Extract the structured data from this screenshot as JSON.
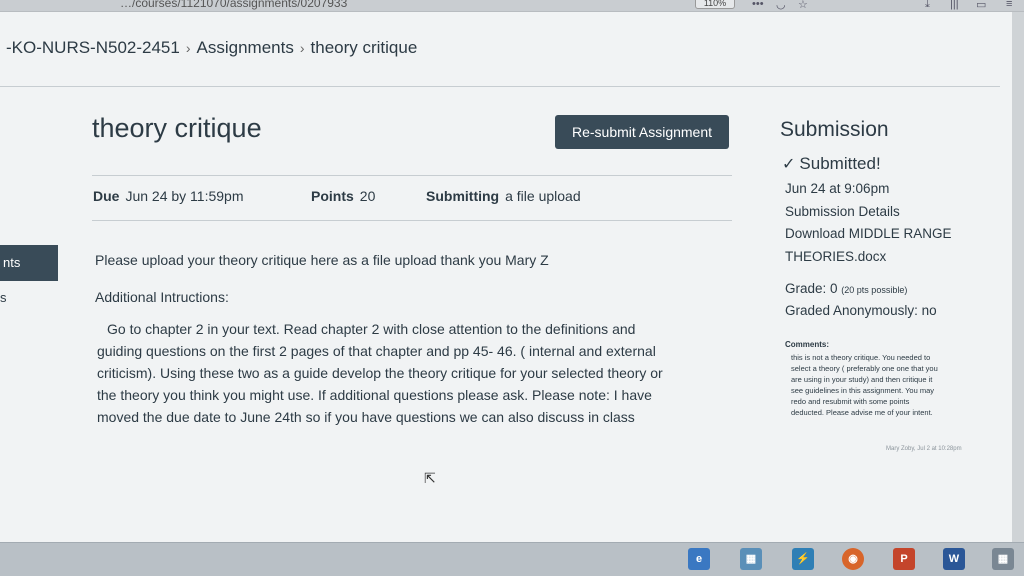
{
  "browser": {
    "url_fragment": "…/courses/1121070/assignments/0207933",
    "zoom": "110%",
    "icons": [
      "more-icon",
      "pocket-icon",
      "star-icon",
      "download-icon",
      "library-icon",
      "sidebar-icon",
      "menu-icon"
    ]
  },
  "breadcrumb": {
    "course": "-KO-NURS-N502-2451",
    "section": "Assignments",
    "current": "theory critique"
  },
  "left_nav": {
    "active_label": "nts",
    "next_label": "s"
  },
  "assignment": {
    "title": "theory critique",
    "resubmit_label": "Re-submit Assignment",
    "due_label": "Due",
    "due_value": "Jun 24 by 11:59pm",
    "points_label": "Points",
    "points_value": "20",
    "submitting_label": "Submitting",
    "submitting_value": "a file upload",
    "description": "Please upload your theory critique here as a file upload  thank you Mary Z",
    "additional_heading": "Additional Intructions:",
    "instructions_lines": [
      "Go to chapter 2 in your text.  Read chapter 2 with close attention to the definitions and",
      "guiding questions on the first 2 pages of that chapter and pp 45- 46.  ( internal and external",
      "criticism).  Using these two as a guide develop the theory critique for your selected theory or",
      "the theory you think you might use.    If additional questions please ask.  Please note:  I have",
      "moved the due date to  June 24th so if you have questions we can also discuss in class"
    ]
  },
  "submission": {
    "heading": "Submission",
    "status": "Submitted!",
    "submitted_at": "Jun 24 at 9:06pm",
    "details_link": "Submission Details",
    "download_line1": "Download MIDDLE RANGE",
    "download_line2": "THEORIES.docx",
    "grade_label": "Grade: 0",
    "grade_possible": "(20 pts possible)",
    "graded_anon": "Graded Anonymously: no",
    "comments_heading": "Comments:",
    "comment_lines": [
      "this is not a theory critique. You needed to",
      "select a theory ( preferably one one that you",
      "are using in your study) and then critique it",
      "see guidelines in this assignment. You may",
      "redo and resubmit with some points",
      "deducted. Please advise me of your intent."
    ],
    "comment_meta": "Mary Zoby, Jul 2 at 10:28pm"
  },
  "taskbar": {
    "icons": [
      "ie-icon",
      "store-icon",
      "shield-icon",
      "firefox-icon",
      "powerpoint-icon",
      "word-icon",
      "apps-icon"
    ]
  }
}
